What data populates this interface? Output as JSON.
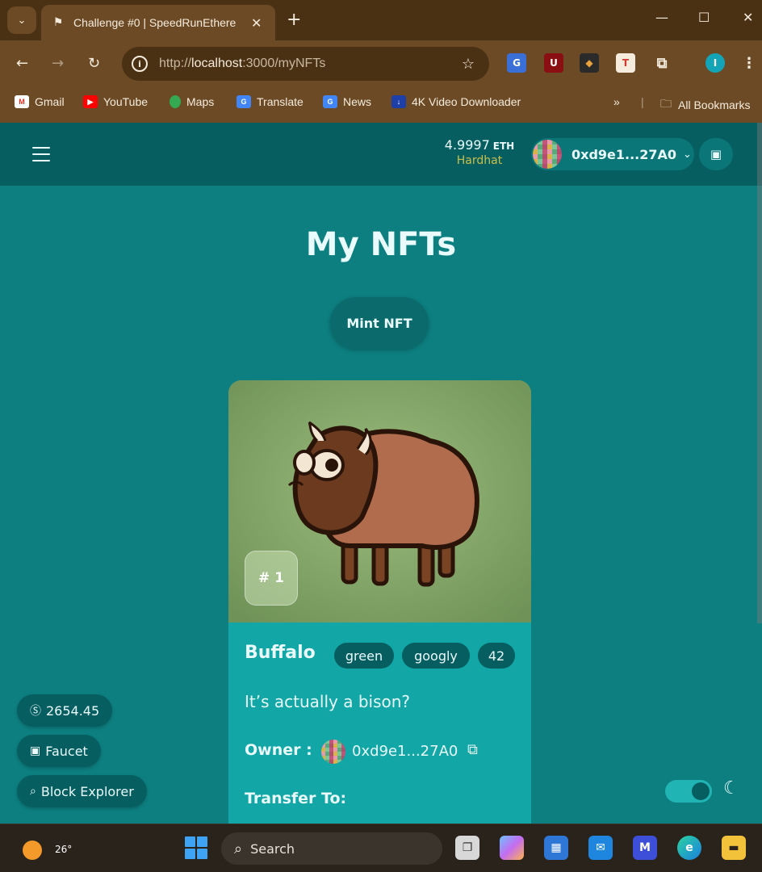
{
  "browser": {
    "tab_title": "Challenge #0 | SpeedRunEthere",
    "url_prefix": "http://",
    "url_host": "localhost",
    "url_rest": ":3000/myNFTs",
    "bookmarks": [
      "Gmail",
      "YouTube",
      "Maps",
      "Translate",
      "News",
      "4K Video Downloader"
    ],
    "all_bookmarks": "All Bookmarks",
    "profile_initial": "I"
  },
  "header": {
    "balance": "4.9997",
    "balance_unit": "ETH",
    "network": "Hardhat",
    "address": "0xd9e1...27A0"
  },
  "page": {
    "title": "My NFTs",
    "mint_label": "Mint NFT"
  },
  "nft": {
    "id_label": "# 1",
    "name": "Buffalo",
    "attributes": [
      "green",
      "googly",
      "42"
    ],
    "description": "It’s actually a bison?",
    "owner_label": "Owner :",
    "owner_address": "0xd9e1...27A0",
    "transfer_label": "Transfer To:"
  },
  "side": {
    "price": "2654.45",
    "faucet": "Faucet",
    "block_explorer": "Block Explorer"
  },
  "taskbar": {
    "temperature": "26°",
    "search_placeholder": "Search"
  },
  "colors": {
    "app_bg": "#0d7f80",
    "header_bg": "#075e60",
    "card_bg": "#12a6a6",
    "network": "#c9c04a"
  }
}
